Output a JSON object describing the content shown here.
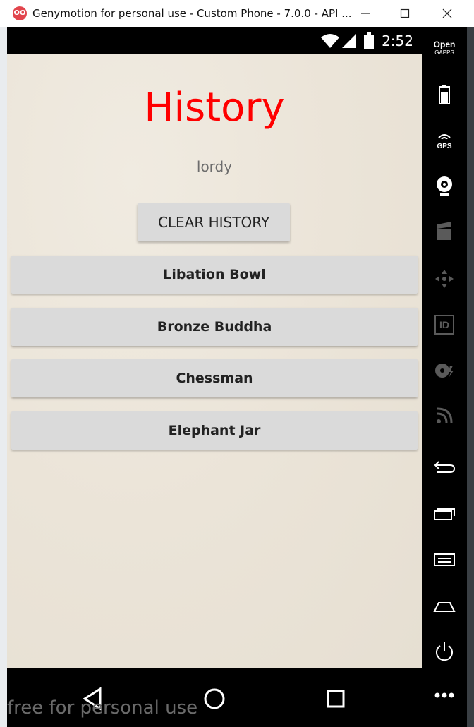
{
  "window": {
    "title": "Genymotion for personal use - Custom Phone - 7.0.0 - API ...",
    "app_icon": "OO",
    "minimize": "minimize-icon",
    "maximize": "maximize-icon",
    "close": "close-icon"
  },
  "statusbar": {
    "time": "2:52"
  },
  "screen": {
    "heading": "History",
    "user": "lordy",
    "clear_label": "CLEAR HISTORY",
    "items": [
      "Libation Bowl",
      "Bronze Buddha",
      "Chessman",
      "Elephant Jar"
    ]
  },
  "sidebar": {
    "gapps_line1": "Open",
    "gapps_line2": "GAPPS",
    "gps_label": "GPS",
    "id_label": "ID"
  },
  "watermark": "free for personal use",
  "colors": {
    "heading": "#ff0000",
    "button": "#dadada",
    "screen_bg": "#ebe4d8"
  }
}
